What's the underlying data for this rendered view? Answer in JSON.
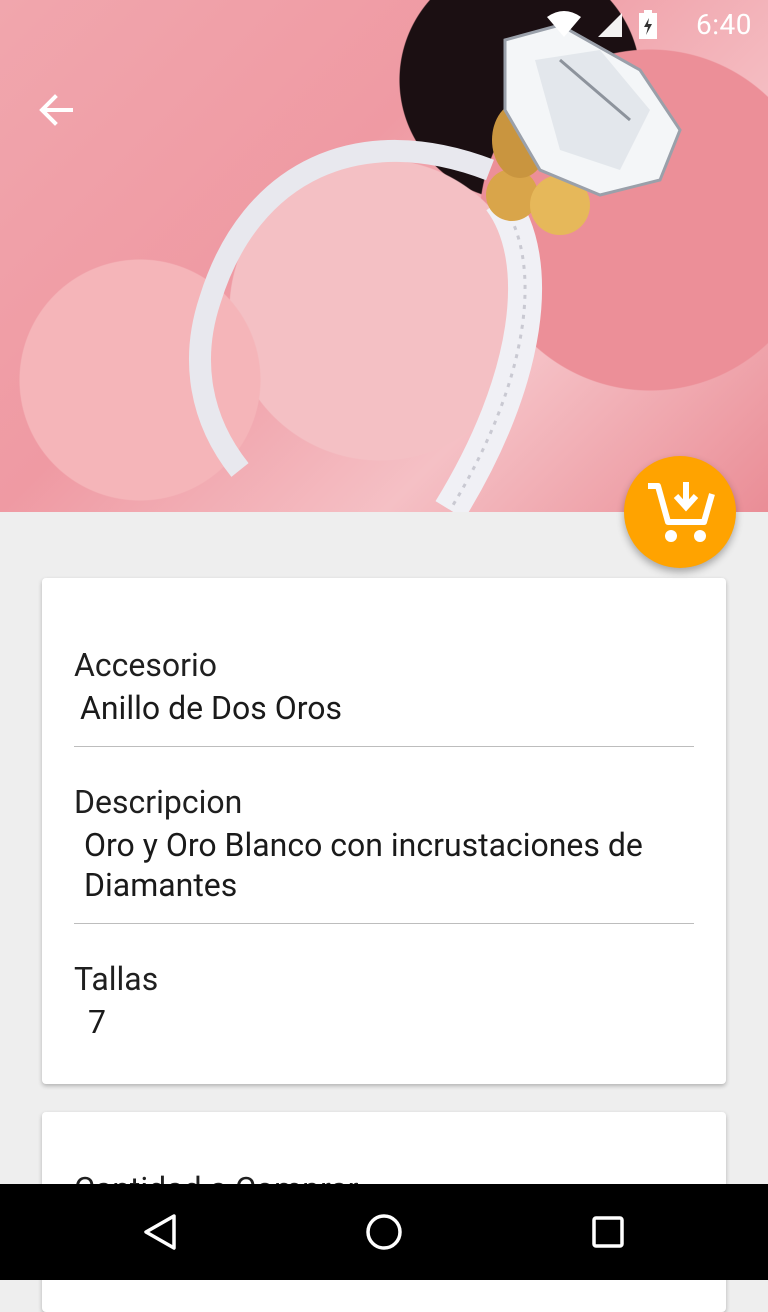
{
  "status": {
    "time": "6:40"
  },
  "product": {
    "accessory_label": "Accesorio",
    "accessory_value": "Anillo de Dos Oros",
    "description_label": "Descripcion",
    "description_value": "Oro y Oro Blanco con incrustaciones de Diamantes",
    "sizes_label": "Tallas",
    "sizes_value": "7"
  },
  "card2": {
    "label": "Cantidad a Comprar"
  },
  "icons": {
    "back": "arrow-back-icon",
    "fab": "add-to-cart-icon",
    "wifi": "wifi-icon",
    "signal": "signal-icon",
    "battery": "battery-charging-icon",
    "nav_back": "nav-back-icon",
    "nav_home": "nav-home-icon",
    "nav_recents": "nav-recents-icon"
  },
  "colors": {
    "fab": "#ffa300",
    "background": "#eeeeee",
    "card": "#ffffff"
  }
}
